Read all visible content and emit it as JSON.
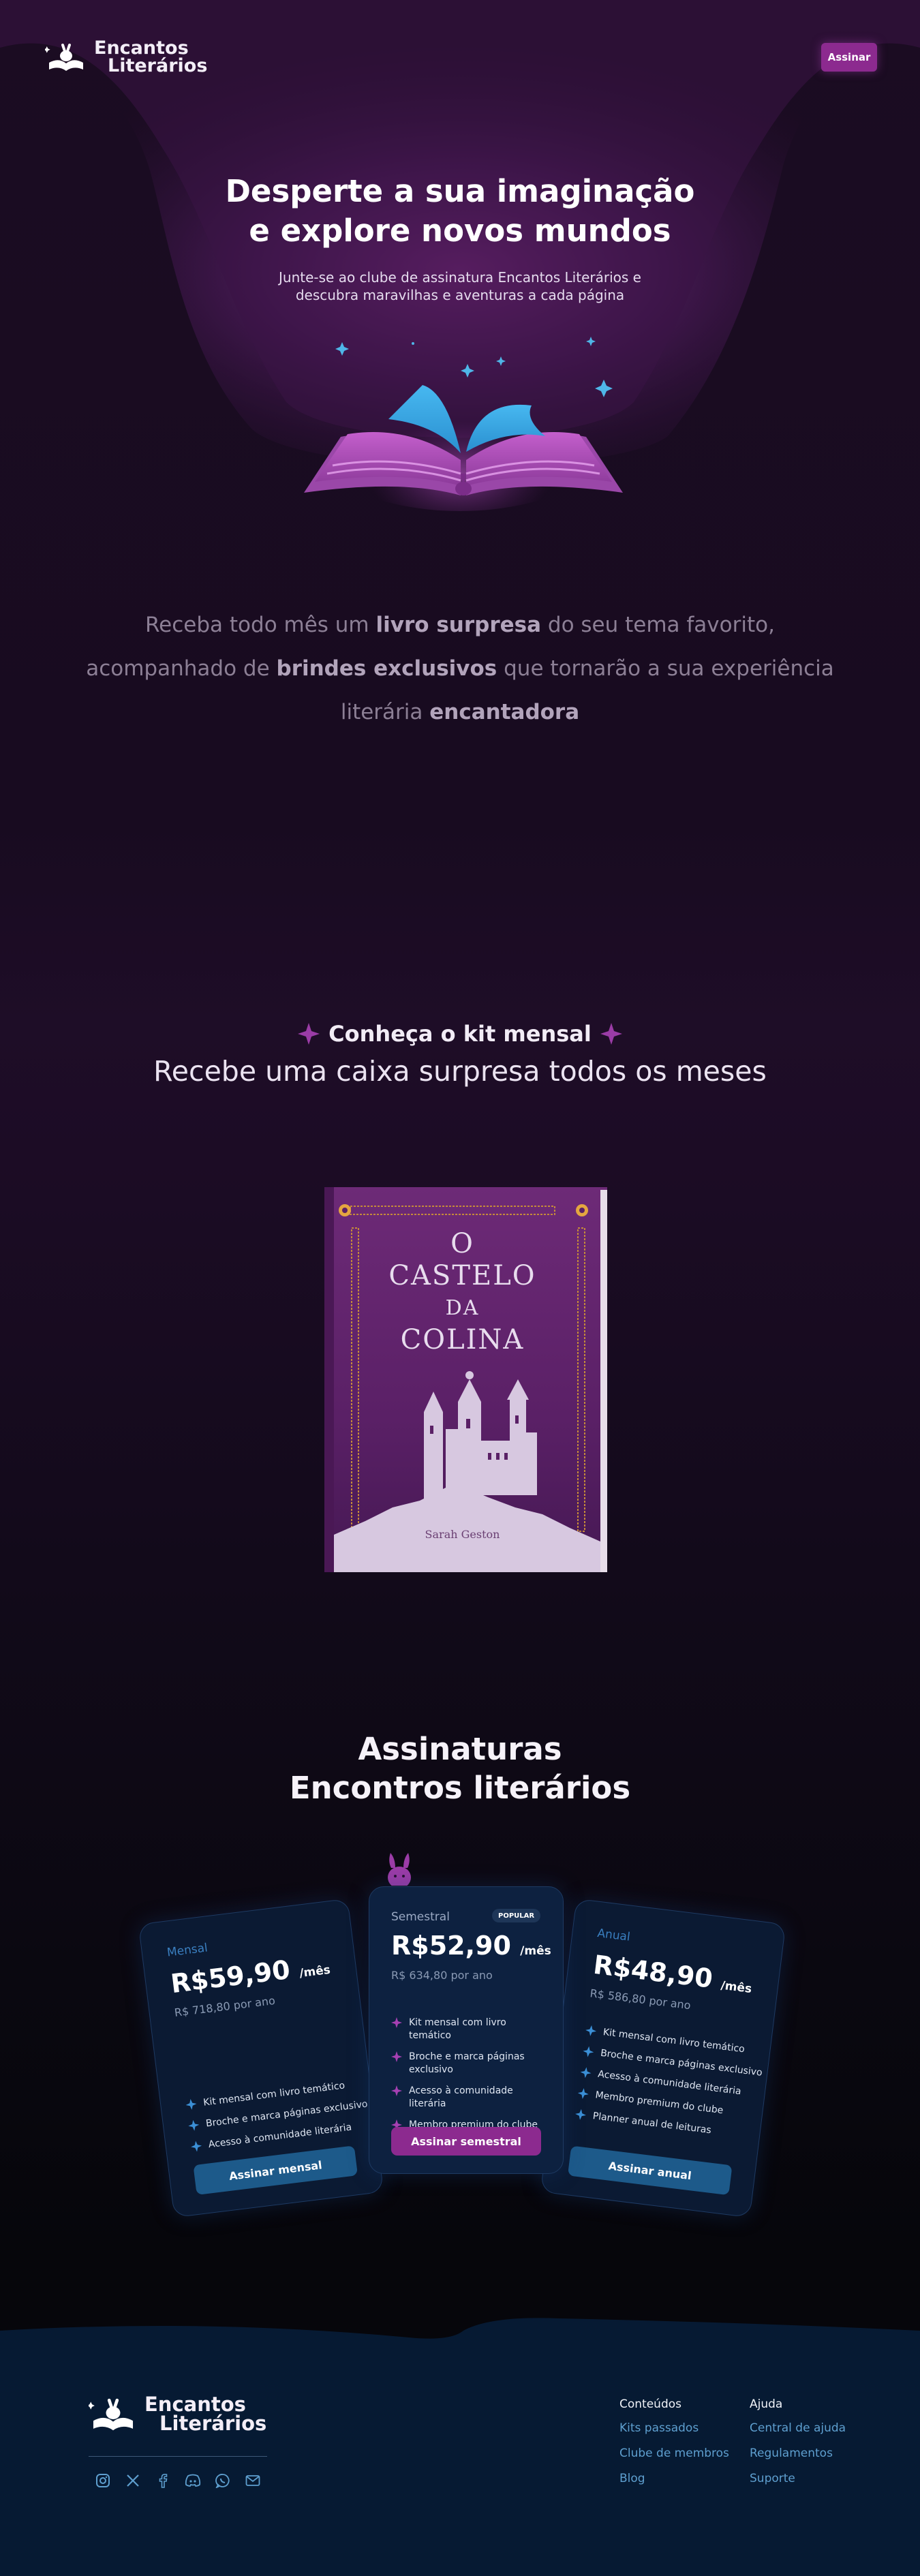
{
  "header": {
    "brand_line1": "Encantos",
    "brand_line2": "Literários",
    "subscribe_label": "Assinar"
  },
  "hero": {
    "title_line1": "Desperte a sua imaginação",
    "title_line2": "e explore novos mundos",
    "subtitle_line1": "Junte-se ao clube de assinatura Encantos Literários e",
    "subtitle_line2": "descubra maravilhas e aventuras a cada página"
  },
  "intro": {
    "t1": "Receba todo mês um ",
    "b1": "livro surpresa",
    "t2": " do seu tema favorito, acompanhado de ",
    "b2": "brindes exclusivos",
    "t3": " que tornarão a sua experiência literária ",
    "b3": "encantadora"
  },
  "kit": {
    "title": "Conheça o kit mensal",
    "subtitle": "Recebe uma caixa surpresa todos os meses",
    "book": {
      "line1": "O",
      "line2": "CASTELO",
      "line3": "DA",
      "line4": "COLINA",
      "author": "Sarah Geston"
    }
  },
  "plans": {
    "title_line1": "Assinaturas",
    "title_line2": "Encontros literários",
    "monthly": {
      "name": "Mensal",
      "price": "R$59,90",
      "unit": "/mês",
      "yearly": "R$ 718,80 por ano",
      "features": [
        "Kit mensal com livro temático",
        "Broche e marca páginas exclusivo",
        "Acesso à comunidade literária"
      ],
      "cta": "Assinar mensal"
    },
    "semester": {
      "name": "Semestral",
      "badge": "POPULAR",
      "price": "R$52,90",
      "unit": "/mês",
      "yearly": "R$ 634,80 por ano",
      "features": [
        "Kit mensal com livro temático",
        "Broche e marca páginas exclusivo",
        "Acesso à comunidade literária",
        "Membro premium do clube"
      ],
      "cta": "Assinar semestral"
    },
    "annual": {
      "name": "Anual",
      "price": "R$48,90",
      "unit": "/mês",
      "yearly": "R$ 586,80 por ano",
      "features": [
        "Kit mensal com livro temático",
        "Broche e marca páginas exclusivo",
        "Acesso à comunidade literária",
        "Membro premium do clube",
        "Planner anual de leituras"
      ],
      "cta": "Assinar anual"
    }
  },
  "footer": {
    "brand_line1": "Encantos",
    "brand_line2": "Literários",
    "social_icons": [
      "instagram-icon",
      "x-icon",
      "facebook-icon",
      "discord-icon",
      "whatsapp-icon",
      "mail-icon"
    ],
    "col1": {
      "title": "Conteúdos",
      "links": [
        "Kits passados",
        "Clube de membros",
        "Blog"
      ]
    },
    "col2": {
      "title": "Ajuda",
      "links": [
        "Central de ajuda",
        "Regulamentos",
        "Suporte"
      ]
    }
  },
  "colors": {
    "accent_purple": "#8c2a8f",
    "accent_blue": "#1d5a8a",
    "card_bg": "#0b1a33",
    "footer_bg": "#061a33"
  }
}
